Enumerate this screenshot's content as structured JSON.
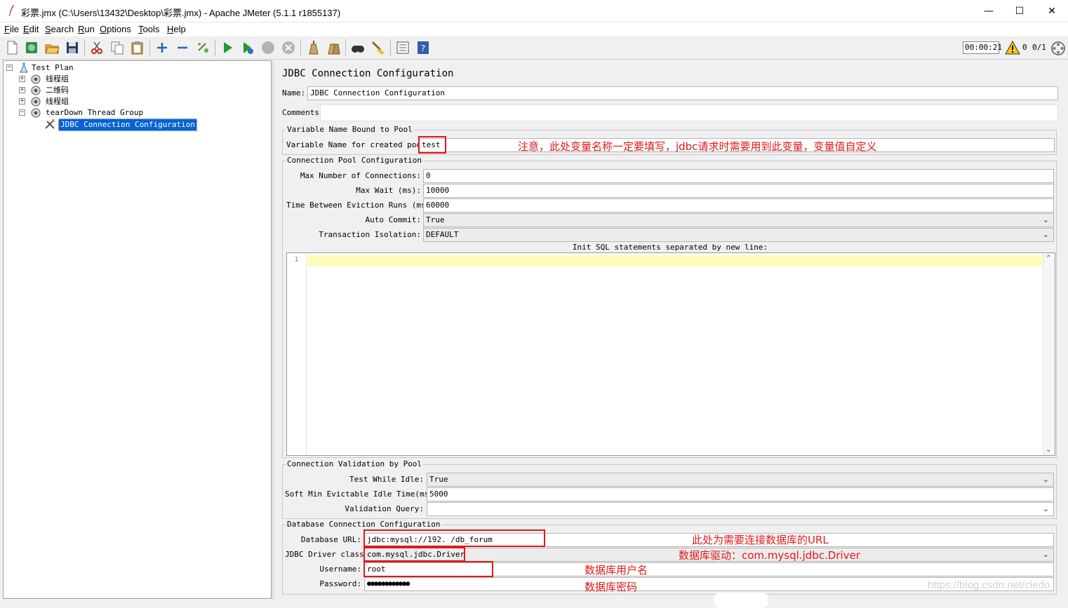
{
  "window": {
    "title": "彩票.jmx (C:\\Users\\13432\\Desktop\\彩票.jmx) - Apache JMeter (5.1.1 r1855137)",
    "minimize": "—",
    "maximize": "☐",
    "close": "✕"
  },
  "menu": [
    "File",
    "Edit",
    "Search",
    "Run",
    "Options",
    "Tools",
    "Help"
  ],
  "toolbar": {
    "buttons": [
      "new-icon",
      "templates-icon",
      "open-icon",
      "save-icon",
      "cut-icon",
      "copy-icon",
      "paste-icon",
      "expand-icon",
      "collapse-icon",
      "toggle-icon",
      "start-icon",
      "start-no-pause-icon",
      "stop-icon",
      "shutdown-icon",
      "clear-icon",
      "clear-all-icon",
      "search-icon",
      "reset-search-icon",
      "function-helper-icon",
      "help-icon"
    ],
    "timer": "00:00:21",
    "warning_count": "0",
    "threads": "0/1"
  },
  "tree": [
    {
      "label": "Test Plan",
      "expander": "−",
      "icon": "test-plan-icon"
    },
    {
      "label": "线程组",
      "expander": "+",
      "icon": "thread-group-icon"
    },
    {
      "label": "二维码",
      "expander": "+",
      "icon": "thread-group-icon"
    },
    {
      "label": "线程组",
      "expander": "+",
      "icon": "thread-group-icon"
    },
    {
      "label": "tearDown Thread Group",
      "expander": "−",
      "icon": "thread-group-icon"
    },
    {
      "label": "JDBC Connection Configuration",
      "icon": "config-element-icon"
    }
  ],
  "panel": {
    "title": "JDBC Connection Configuration",
    "name_label": "Name:",
    "name_value": "JDBC Connection Configuration",
    "comments_label": "Comments:",
    "comments_value": "",
    "var_group_title": "Variable Name Bound to Pool",
    "var_label": "Variable Name for created pool:",
    "var_value": "test",
    "pool_group_title": "Connection Pool Configuration",
    "max_conn_label": "Max Number of Connections:",
    "max_conn_value": "0",
    "max_wait_label": "Max Wait (ms):",
    "max_wait_value": "10000",
    "eviction_label": "Time Between Eviction Runs (ms):",
    "eviction_value": "60000",
    "auto_commit_label": "Auto Commit:",
    "auto_commit_value": "True",
    "isolation_label": "Transaction Isolation:",
    "isolation_value": "DEFAULT",
    "init_sql_label": "Init SQL statements separated by new line:",
    "init_sql_line_number": "1",
    "validation_group_title": "Connection Validation by Pool",
    "test_idle_label": "Test While Idle:",
    "test_idle_value": "True",
    "soft_min_label": "Soft Min Evictable Idle Time(ms):",
    "soft_min_value": "5000",
    "validation_query_label": "Validation Query:",
    "validation_query_value": "",
    "db_group_title": "Database Connection Configuration",
    "db_url_label": "Database URL:",
    "db_url_value": "jdbc:mysql://192.            /db_forum",
    "driver_label": "JDBC Driver class:",
    "driver_value": "com.mysql.jdbc.Driver",
    "username_label": "Username:",
    "username_value": "root",
    "password_label": "Password:",
    "password_value": "●●●●●●●●●●●●"
  },
  "annotations": {
    "var_note": "注意，此处变量名称一定要填写，jdbc请求时需要用到此变量，变量值自定义",
    "url_note": "此处为需要连接数据库的URL",
    "driver_note": "数据库驱动：com.mysql.jdbc.Driver",
    "user_note": "数据库用户名",
    "password_note": "数据库密码",
    "color": "#e0191a"
  },
  "watermark": "https://blog.csdn.net/cledo"
}
